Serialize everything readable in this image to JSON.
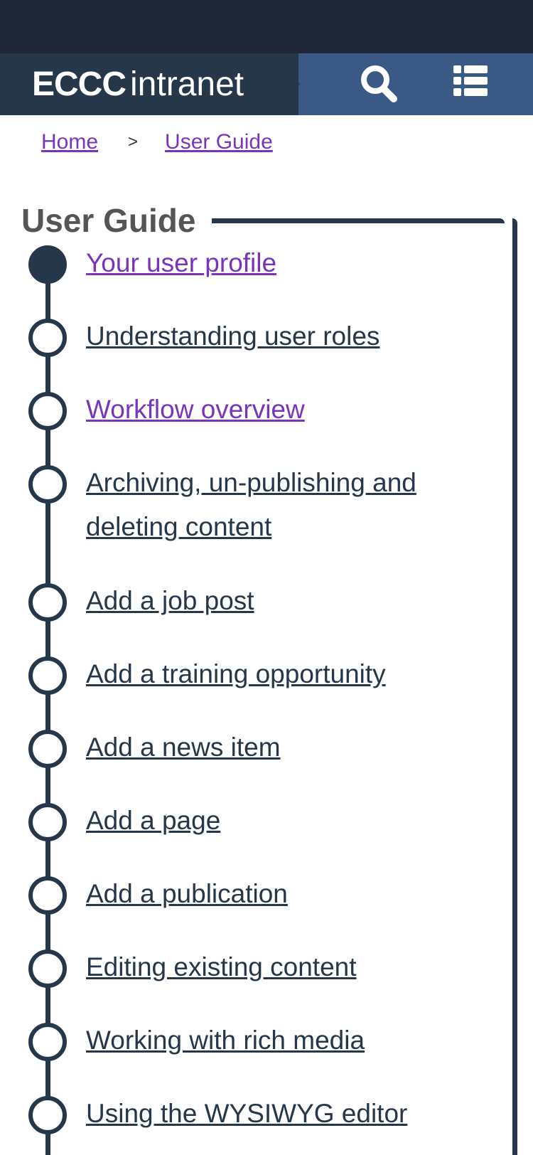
{
  "header": {
    "brand_strong": "ECCC",
    "brand_light": "intranet",
    "search_icon": "search-icon",
    "menu_icon": "list-menu-icon"
  },
  "breadcrumb": {
    "items": [
      "Home",
      "User Guide"
    ],
    "separator": ">"
  },
  "guide": {
    "title": "User Guide",
    "steps": [
      {
        "label": "Your user profile",
        "state": "current-visited"
      },
      {
        "label": "Understanding user roles",
        "state": "default"
      },
      {
        "label": "Workflow overview",
        "state": "visited"
      },
      {
        "label": "Archiving, un-publishing and deleting content",
        "state": "default"
      },
      {
        "label": "Add a job post",
        "state": "default"
      },
      {
        "label": "Add a training opportunity",
        "state": "default"
      },
      {
        "label": "Add a news item",
        "state": "default"
      },
      {
        "label": "Add a page",
        "state": "default"
      },
      {
        "label": "Add a publication",
        "state": "default"
      },
      {
        "label": "Editing existing content",
        "state": "default"
      },
      {
        "label": "Working with rich media",
        "state": "default"
      },
      {
        "label": "Using the WYSIWYG editor",
        "state": "default"
      }
    ]
  },
  "colors": {
    "status_bar": "#1f2638",
    "header_bg": "#3a5a85",
    "brand_bg": "#26374a",
    "link": "#26374a",
    "visited_link": "#7834bc",
    "title": "#555555"
  }
}
